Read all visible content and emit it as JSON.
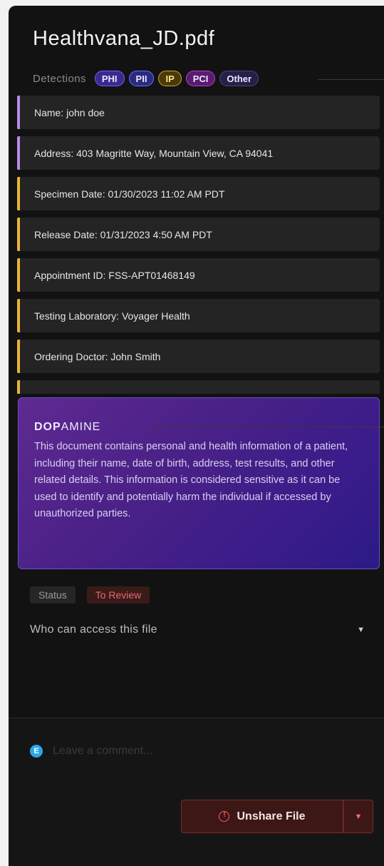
{
  "file": {
    "title": "Healthvana_JD.pdf"
  },
  "detections": {
    "label": "Detections",
    "chips": [
      "PHI",
      "PII",
      "IP",
      "PCI",
      "Other"
    ]
  },
  "items": [
    {
      "text": "Name: john doe",
      "color": "purple"
    },
    {
      "text": "Address: 403 Magritte Way, Mountain View, CA 94041",
      "color": "purple"
    },
    {
      "text": "Specimen Date: 01/30/2023 11:02 AM PDT",
      "color": "yellow"
    },
    {
      "text": "Release Date: 01/31/2023 4:50 AM PDT",
      "color": "yellow"
    },
    {
      "text": "Appointment ID: FSS-APT01468149",
      "color": "yellow"
    },
    {
      "text": "Testing Laboratory: Voyager Health",
      "color": "yellow"
    },
    {
      "text": "Ordering Doctor: John Smith",
      "color": "yellow"
    },
    {
      "text": "",
      "color": "yellow"
    }
  ],
  "summary": {
    "brand_bold": "DOP",
    "brand_light": "AMINE",
    "text": "This document contains personal and health information of a patient, including their name, date of birth, address, test results, and other related details. This information is considered sensitive as it can be used to identify and potentially harm the individual if accessed by unauthorized parties."
  },
  "status": {
    "label": "Status",
    "value": "To Review"
  },
  "access": {
    "label": "Who can access this file"
  },
  "comment": {
    "avatar": "E",
    "placeholder": "Leave a comment..."
  },
  "actions": {
    "unshare_label": "Unshare File"
  },
  "colors": {
    "accent_purple": "#b98ce8",
    "accent_yellow": "#e8b33a",
    "danger": "#ff5a5a"
  }
}
